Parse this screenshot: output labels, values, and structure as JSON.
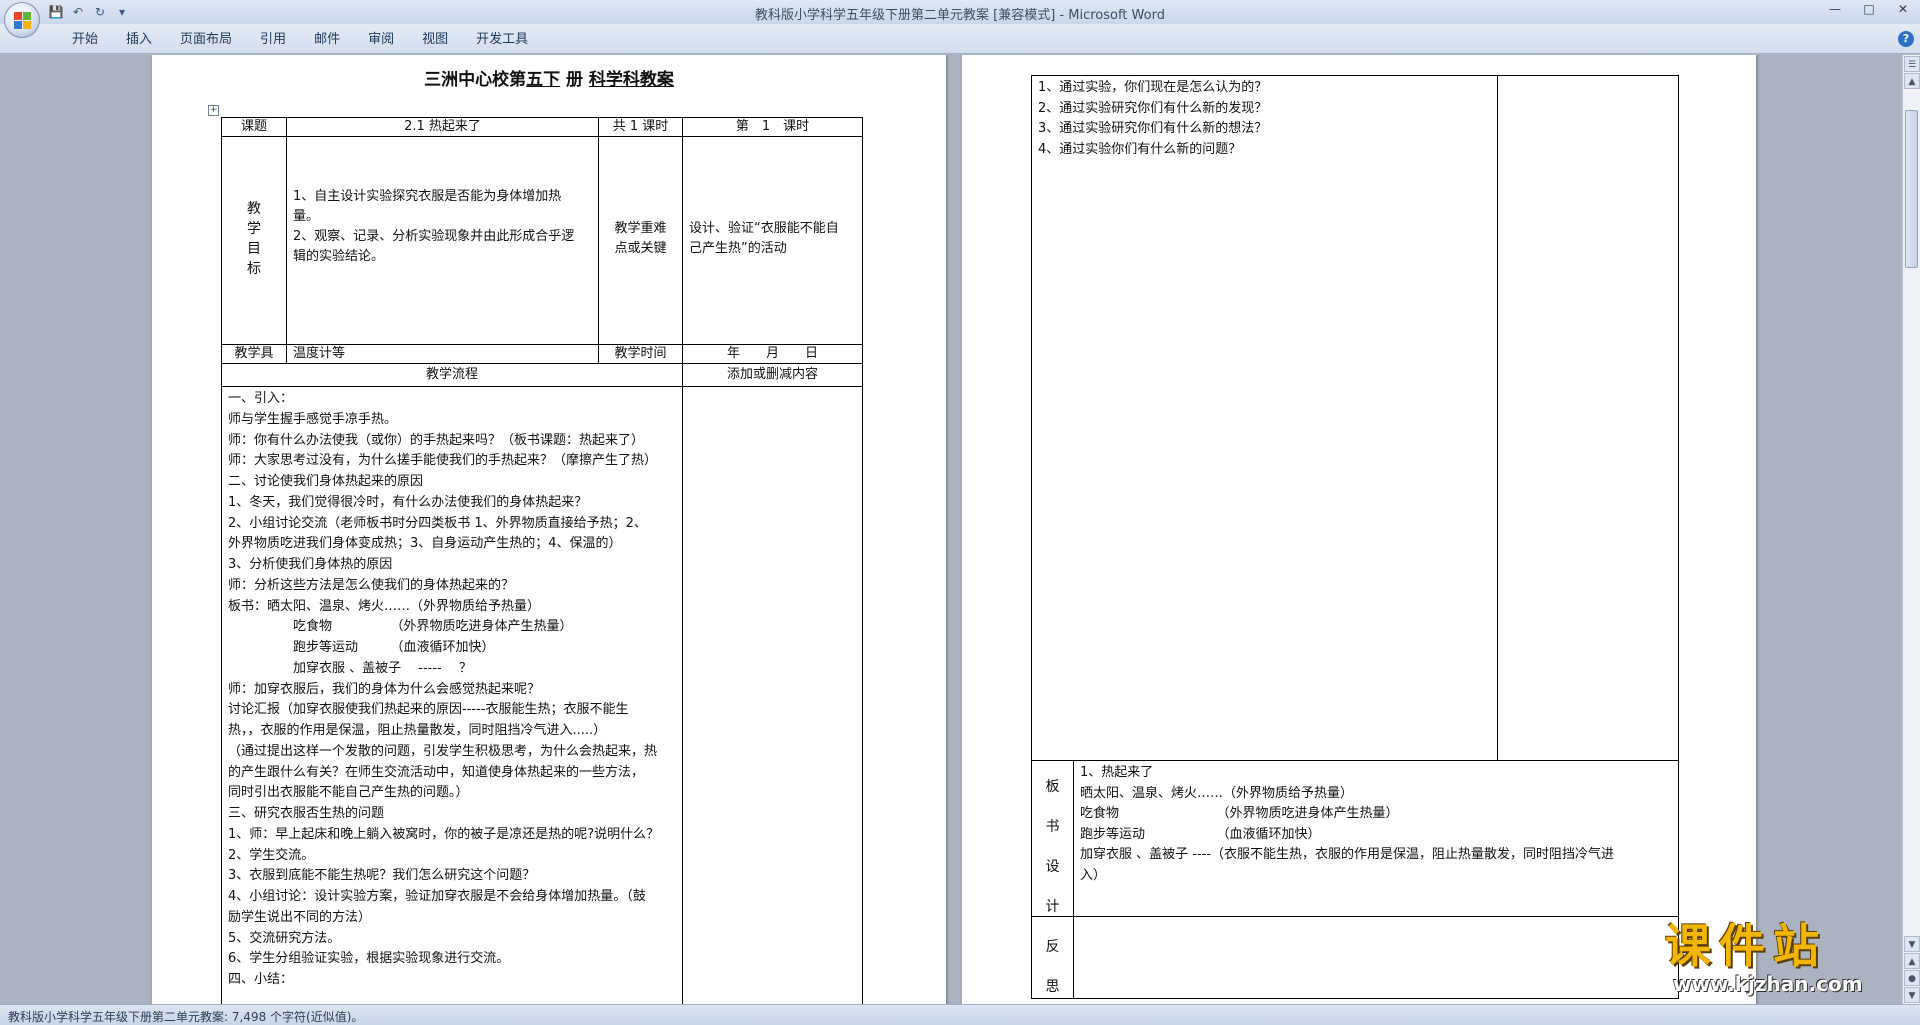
{
  "app": {
    "title": "教科版小学科学五年级下册第二单元教案 [兼容模式] - Microsoft Word",
    "tabs": [
      "开始",
      "插入",
      "页面布局",
      "引用",
      "邮件",
      "审阅",
      "视图",
      "开发工具"
    ],
    "status": "教科版小学科学五年级下册第二单元教案: 7,498 个字符(近似值)。",
    "help": "?"
  },
  "left_page": {
    "title_pre": "三洲中心校第",
    "title_grade": "五下",
    "title_mid": "册",
    "title_subject": "科学科教案",
    "row1": {
      "label_topic": "课题",
      "topic": "2.1 热起来了",
      "total_periods": "共 1 课时",
      "current_period": "第　1　课时"
    },
    "goals_label": [
      "教",
      "学",
      "目",
      "标"
    ],
    "goals": [
      "1、自主设计实验探究衣服是否能为身体增加热",
      "量。",
      "2、观察、记录、分析实验现象并由此形成合乎逻",
      "辑的实验结论。"
    ],
    "key_label": [
      "教学重难",
      "点或关键"
    ],
    "key_text": [
      "设计、验证“衣服能不能自",
      "己产生热”的活动"
    ],
    "tools_label": "教学具",
    "tools": "温度计等",
    "time_label": "教学时间",
    "time_value": "年　　月　　日",
    "flow_label": "教学流程",
    "add_label": "添加或删减内容",
    "flow_lines": [
      "一、引入：",
      "师与学生握手感觉手凉手热。",
      "师：你有什么办法使我（或你）的手热起来吗？（板书课题：热起来了）",
      "师：大家思考过没有，为什么搓手能使我们的手热起来？（摩擦产生了热）",
      "二、讨论使我们身体热起来的原因",
      "1、冬天，我们觉得很冷时，有什么办法使我们的身体热起来？",
      "2、小组讨论交流（老师板书时分四类板书 1、外界物质直接给予热；2、",
      "外界物质吃进我们身体变成热；3、自身运动产生热的；4、保温的）",
      "3、分析使我们身体热的原因",
      "师：分析这些方法是怎么使我们的身体热起来的？",
      "板书：晒太阳、温泉、烤火……（外界物质给予热量）",
      "　　　　　吃食物　　　　　（外界物质吃进身体产生热量）",
      "　　　　　跑步等运动　　　（血液循环加快）",
      "　　　　　加穿衣服 、盖被子　 -----　 ？",
      "师：加穿衣服后，我们的身体为什么会感觉热起来呢？",
      "讨论汇报（加穿衣服使我们热起来的原因-----衣服能生热；衣服不能生",
      "热，，衣服的作用是保温，阻止热量散发，同时阻挡冷气进入.....）",
      "（通过提出这样一个发散的问题，引发学生积极思考，为什么会热起来，热",
      "的产生跟什么有关？在师生交流活动中，知道使身体热起来的一些方法，",
      "同时引出衣服能不能自己产生热的问题。）",
      "三、研究衣服否生热的问题",
      "1、师：早上起床和晚上躺入被窝时，你的被子是凉还是热的呢?说明什么？",
      "2、学生交流。",
      "3、衣服到底能不能生热呢？我们怎么研究这个问题？",
      "4、小组讨论：设计实验方案，验证加穿衣服是不会给身体增加热量。（鼓",
      "励学生说出不同的方法）",
      "5、交流研究方法。",
      "6、学生分组验证实验，根据实验现象进行交流。",
      "四、小结："
    ]
  },
  "right_page": {
    "questions": [
      "1、通过实验，你们现在是怎么认为的？",
      "2、通过实验研究你们有什么新的发现？",
      "3、通过实验研究你们有什么新的想法？",
      "4、通过实验你们有什么新的问题？"
    ],
    "board_label": [
      "板",
      "书",
      "设",
      "计"
    ],
    "board_lines": [
      "1、热起来了",
      "晒太阳、温泉、烤火……（外界物质给予热量）",
      "吃食物　　　　　　　　（外界物质吃进身体产生热量）",
      "跑步等运动　　　　　　（血液循环加快）",
      "加穿衣服 、盖被子 ----（衣服不能生热，衣服的作用是保温，阻止热量散发，同时阻挡冷气进",
      "入）"
    ],
    "reflect_label": [
      "反",
      "思"
    ]
  },
  "watermark": {
    "big": "课件站",
    "url": "www.kjzhan.com"
  },
  "colors": {
    "ribbon": "#d3deee",
    "workspace": "#aab3bf",
    "watermark": "#f2b600"
  }
}
